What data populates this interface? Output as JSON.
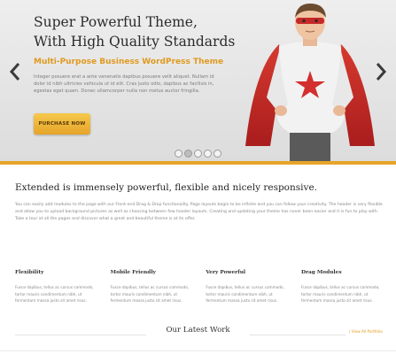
{
  "hero": {
    "title_line1": "Super Powerful Theme,",
    "title_line2": "With High Quality Standards",
    "subtitle": "Multi-Purpose Business WordPress Theme",
    "text": "Integer posuere erat a ante venenatis dapibus posuere velit aliquet. Nullam id dolor id nibh ultricies vehicula ut id elit. Cras justo odio, dapibus ac facilisis in, egestas eget quam. Donec ullamcorper nulla non metus auctor fringilla.",
    "button_label": "PURCHASE NOW",
    "slide_count": 5,
    "active_slide": 1
  },
  "intro": {
    "heading": "Extended is immensely powerful, flexible and nicely responsive.",
    "text": "You can easily add modules to the page with our Front-end Drag & Drop functionality. Page layouts begin to be infinite and you can follow your creativity. The header is very flexible and allow you to upload background pictures as well as choosing between few header layouts. Creating and updating your theme has never been easier and it is fun to play with. Take a tour at all the pages and discover what a great and beautiful theme is at its offer."
  },
  "features": [
    {
      "title": "Flexibility",
      "text": "Fusce dapibus, tellus ac cursus commodo, tortor mauris condimentum nibh, ut fermentum massa justo sit amet risus."
    },
    {
      "title": "Mobile Friendly",
      "text": "Fusce dapibus, tellus ac cursus commodo, tortor mauris condimentum nibh, ut fermentum massa justo sit amet risus."
    },
    {
      "title": "Very Powerful",
      "text": "Fusce dapibus, tellus ac cursus commodo, tortor mauris condimentum nibh, ut fermentum massa justo sit amet risus."
    },
    {
      "title": "Drag Modules",
      "text": "Fusce dapibus, tellus ac cursus commodo, tortor mauris condimentum nibh, ut fermentum massa justo sit amet risus."
    }
  ],
  "latest_work": {
    "heading": "Our Latest Work",
    "view_all": "/ View All Portfolio"
  },
  "colors": {
    "accent": "#e6a42a",
    "cape": "#c62828",
    "star": "#d32f2f"
  },
  "icons": {
    "prev": "chevron-left-icon",
    "next": "chevron-right-icon"
  }
}
